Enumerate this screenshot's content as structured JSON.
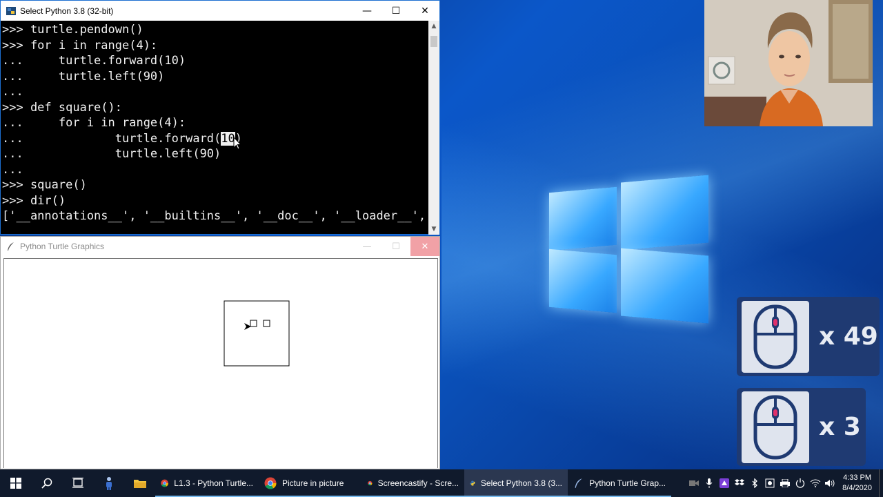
{
  "console": {
    "title": "Select Python 3.8 (32-bit)",
    "lines": [
      ">>> turtle.pendown()",
      ">>> for i in range(4):",
      "...     turtle.forward(10)",
      "...     turtle.left(90)",
      "...",
      ">>> def square():",
      "...     for i in range(4):",
      "...             turtle.forward(",
      "...             turtle.left(90)",
      "...",
      ">>> square()",
      ">>> dir()",
      "['__annotations__', '__builtins__', '__doc__', '__loader__',"
    ],
    "selected_text": "10",
    "after_selection": ")"
  },
  "turtle_window": {
    "title": "Python Turtle Graphics"
  },
  "click_counters": {
    "left": {
      "count": "x 49"
    },
    "right": {
      "count": "x 3"
    }
  },
  "taskbar": {
    "apps": [
      {
        "label": "L1.3 - Python Turtle...",
        "icon": "chrome-icon"
      },
      {
        "label": "Picture in picture",
        "icon": "chrome-icon"
      },
      {
        "label": "Screencastify - Scre...",
        "icon": "chrome-icon"
      },
      {
        "label": "Select Python 3.8 (3...",
        "icon": "python-icon",
        "active": true
      },
      {
        "label": "Python Turtle Grap...",
        "icon": "feather-icon"
      }
    ],
    "clock": {
      "time": "4:33 PM",
      "date": "8/4/2020"
    }
  },
  "colors": {
    "desktop_blue": "#0b57c9",
    "taskbar": "#101a2c",
    "counter_panel": "#1f3a72",
    "mouse_wheel": "#e0306a"
  }
}
